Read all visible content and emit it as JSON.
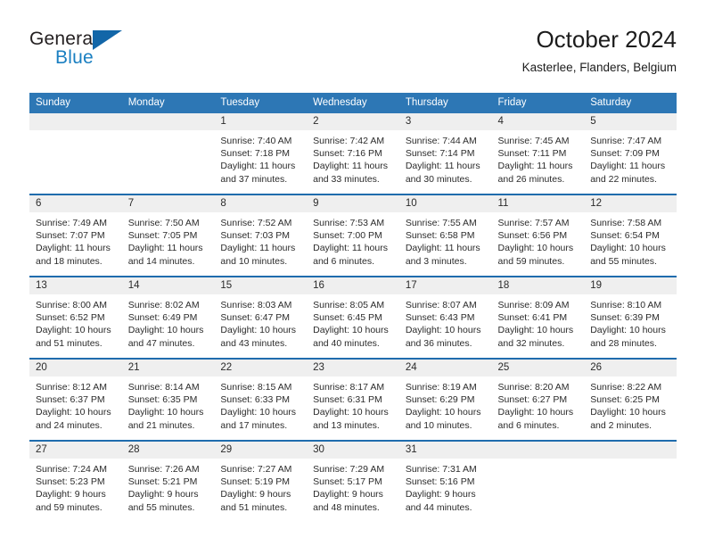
{
  "brand": {
    "name_top": "General",
    "name_bottom": "Blue",
    "triangle_color": "#1266a8",
    "blue_text_color": "#1a7fc1"
  },
  "header": {
    "title": "October 2024",
    "subtitle": "Kasterlee, Flanders, Belgium"
  },
  "theme": {
    "header_bg": "#2d77b5",
    "week_divider": "#1f6cad",
    "daynum_bg": "#efefef",
    "text": "#2b2b2b"
  },
  "weekday_headers": [
    "Sunday",
    "Monday",
    "Tuesday",
    "Wednesday",
    "Thursday",
    "Friday",
    "Saturday"
  ],
  "labels": {
    "sunrise_prefix": "Sunrise: ",
    "sunset_prefix": "Sunset: ",
    "daylight_prefix": "Daylight: "
  },
  "weeks": [
    [
      {
        "date": "",
        "sunrise": "",
        "sunset": "",
        "daylight_line1": "",
        "daylight_line2": ""
      },
      {
        "date": "",
        "sunrise": "",
        "sunset": "",
        "daylight_line1": "",
        "daylight_line2": ""
      },
      {
        "date": "1",
        "sunrise": "Sunrise: 7:40 AM",
        "sunset": "Sunset: 7:18 PM",
        "daylight_line1": "Daylight: 11 hours",
        "daylight_line2": "and 37 minutes."
      },
      {
        "date": "2",
        "sunrise": "Sunrise: 7:42 AM",
        "sunset": "Sunset: 7:16 PM",
        "daylight_line1": "Daylight: 11 hours",
        "daylight_line2": "and 33 minutes."
      },
      {
        "date": "3",
        "sunrise": "Sunrise: 7:44 AM",
        "sunset": "Sunset: 7:14 PM",
        "daylight_line1": "Daylight: 11 hours",
        "daylight_line2": "and 30 minutes."
      },
      {
        "date": "4",
        "sunrise": "Sunrise: 7:45 AM",
        "sunset": "Sunset: 7:11 PM",
        "daylight_line1": "Daylight: 11 hours",
        "daylight_line2": "and 26 minutes."
      },
      {
        "date": "5",
        "sunrise": "Sunrise: 7:47 AM",
        "sunset": "Sunset: 7:09 PM",
        "daylight_line1": "Daylight: 11 hours",
        "daylight_line2": "and 22 minutes."
      }
    ],
    [
      {
        "date": "6",
        "sunrise": "Sunrise: 7:49 AM",
        "sunset": "Sunset: 7:07 PM",
        "daylight_line1": "Daylight: 11 hours",
        "daylight_line2": "and 18 minutes."
      },
      {
        "date": "7",
        "sunrise": "Sunrise: 7:50 AM",
        "sunset": "Sunset: 7:05 PM",
        "daylight_line1": "Daylight: 11 hours",
        "daylight_line2": "and 14 minutes."
      },
      {
        "date": "8",
        "sunrise": "Sunrise: 7:52 AM",
        "sunset": "Sunset: 7:03 PM",
        "daylight_line1": "Daylight: 11 hours",
        "daylight_line2": "and 10 minutes."
      },
      {
        "date": "9",
        "sunrise": "Sunrise: 7:53 AM",
        "sunset": "Sunset: 7:00 PM",
        "daylight_line1": "Daylight: 11 hours",
        "daylight_line2": "and 6 minutes."
      },
      {
        "date": "10",
        "sunrise": "Sunrise: 7:55 AM",
        "sunset": "Sunset: 6:58 PM",
        "daylight_line1": "Daylight: 11 hours",
        "daylight_line2": "and 3 minutes."
      },
      {
        "date": "11",
        "sunrise": "Sunrise: 7:57 AM",
        "sunset": "Sunset: 6:56 PM",
        "daylight_line1": "Daylight: 10 hours",
        "daylight_line2": "and 59 minutes."
      },
      {
        "date": "12",
        "sunrise": "Sunrise: 7:58 AM",
        "sunset": "Sunset: 6:54 PM",
        "daylight_line1": "Daylight: 10 hours",
        "daylight_line2": "and 55 minutes."
      }
    ],
    [
      {
        "date": "13",
        "sunrise": "Sunrise: 8:00 AM",
        "sunset": "Sunset: 6:52 PM",
        "daylight_line1": "Daylight: 10 hours",
        "daylight_line2": "and 51 minutes."
      },
      {
        "date": "14",
        "sunrise": "Sunrise: 8:02 AM",
        "sunset": "Sunset: 6:49 PM",
        "daylight_line1": "Daylight: 10 hours",
        "daylight_line2": "and 47 minutes."
      },
      {
        "date": "15",
        "sunrise": "Sunrise: 8:03 AM",
        "sunset": "Sunset: 6:47 PM",
        "daylight_line1": "Daylight: 10 hours",
        "daylight_line2": "and 43 minutes."
      },
      {
        "date": "16",
        "sunrise": "Sunrise: 8:05 AM",
        "sunset": "Sunset: 6:45 PM",
        "daylight_line1": "Daylight: 10 hours",
        "daylight_line2": "and 40 minutes."
      },
      {
        "date": "17",
        "sunrise": "Sunrise: 8:07 AM",
        "sunset": "Sunset: 6:43 PM",
        "daylight_line1": "Daylight: 10 hours",
        "daylight_line2": "and 36 minutes."
      },
      {
        "date": "18",
        "sunrise": "Sunrise: 8:09 AM",
        "sunset": "Sunset: 6:41 PM",
        "daylight_line1": "Daylight: 10 hours",
        "daylight_line2": "and 32 minutes."
      },
      {
        "date": "19",
        "sunrise": "Sunrise: 8:10 AM",
        "sunset": "Sunset: 6:39 PM",
        "daylight_line1": "Daylight: 10 hours",
        "daylight_line2": "and 28 minutes."
      }
    ],
    [
      {
        "date": "20",
        "sunrise": "Sunrise: 8:12 AM",
        "sunset": "Sunset: 6:37 PM",
        "daylight_line1": "Daylight: 10 hours",
        "daylight_line2": "and 24 minutes."
      },
      {
        "date": "21",
        "sunrise": "Sunrise: 8:14 AM",
        "sunset": "Sunset: 6:35 PM",
        "daylight_line1": "Daylight: 10 hours",
        "daylight_line2": "and 21 minutes."
      },
      {
        "date": "22",
        "sunrise": "Sunrise: 8:15 AM",
        "sunset": "Sunset: 6:33 PM",
        "daylight_line1": "Daylight: 10 hours",
        "daylight_line2": "and 17 minutes."
      },
      {
        "date": "23",
        "sunrise": "Sunrise: 8:17 AM",
        "sunset": "Sunset: 6:31 PM",
        "daylight_line1": "Daylight: 10 hours",
        "daylight_line2": "and 13 minutes."
      },
      {
        "date": "24",
        "sunrise": "Sunrise: 8:19 AM",
        "sunset": "Sunset: 6:29 PM",
        "daylight_line1": "Daylight: 10 hours",
        "daylight_line2": "and 10 minutes."
      },
      {
        "date": "25",
        "sunrise": "Sunrise: 8:20 AM",
        "sunset": "Sunset: 6:27 PM",
        "daylight_line1": "Daylight: 10 hours",
        "daylight_line2": "and 6 minutes."
      },
      {
        "date": "26",
        "sunrise": "Sunrise: 8:22 AM",
        "sunset": "Sunset: 6:25 PM",
        "daylight_line1": "Daylight: 10 hours",
        "daylight_line2": "and 2 minutes."
      }
    ],
    [
      {
        "date": "27",
        "sunrise": "Sunrise: 7:24 AM",
        "sunset": "Sunset: 5:23 PM",
        "daylight_line1": "Daylight: 9 hours",
        "daylight_line2": "and 59 minutes."
      },
      {
        "date": "28",
        "sunrise": "Sunrise: 7:26 AM",
        "sunset": "Sunset: 5:21 PM",
        "daylight_line1": "Daylight: 9 hours",
        "daylight_line2": "and 55 minutes."
      },
      {
        "date": "29",
        "sunrise": "Sunrise: 7:27 AM",
        "sunset": "Sunset: 5:19 PM",
        "daylight_line1": "Daylight: 9 hours",
        "daylight_line2": "and 51 minutes."
      },
      {
        "date": "30",
        "sunrise": "Sunrise: 7:29 AM",
        "sunset": "Sunset: 5:17 PM",
        "daylight_line1": "Daylight: 9 hours",
        "daylight_line2": "and 48 minutes."
      },
      {
        "date": "31",
        "sunrise": "Sunrise: 7:31 AM",
        "sunset": "Sunset: 5:16 PM",
        "daylight_line1": "Daylight: 9 hours",
        "daylight_line2": "and 44 minutes."
      },
      {
        "date": "",
        "sunrise": "",
        "sunset": "",
        "daylight_line1": "",
        "daylight_line2": ""
      },
      {
        "date": "",
        "sunrise": "",
        "sunset": "",
        "daylight_line1": "",
        "daylight_line2": ""
      }
    ]
  ]
}
